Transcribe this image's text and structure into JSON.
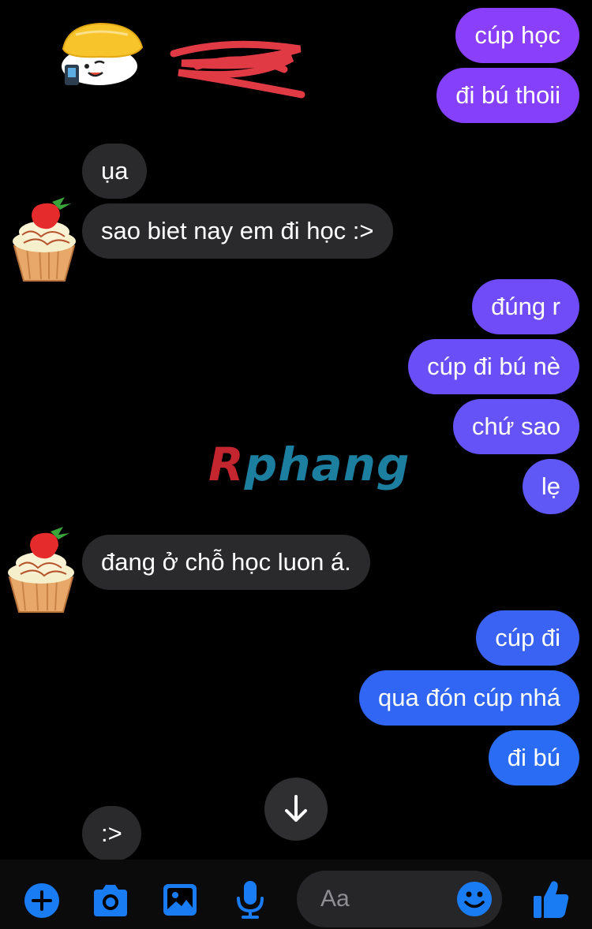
{
  "messages": {
    "m1": "cúp học",
    "m2": "đi bú thoii",
    "m3": "ụa",
    "m4": "sao biet nay em đi học :>",
    "m5": "đúng r",
    "m6": "cúp đi bú nè",
    "m7": "chứ sao",
    "m8": "lẹ",
    "m9": "đang ở chỗ học luon á.",
    "m10": "cúp đi",
    "m11": "qua đón cúp nhá",
    "m12": "đi bú",
    "m13": ":>"
  },
  "watermark": {
    "first": "R",
    "rest": "phang"
  },
  "composer": {
    "placeholder": "Aa"
  },
  "colors": {
    "incoming": "#2a2a2c",
    "gradient_top": "#8a3ffb",
    "gradient_mid": "#5b5cf6",
    "gradient_bottom": "#2a6cf3",
    "accent": "#1a7cf3"
  },
  "icons": [
    "sushi-sticker",
    "cupcake-avatar",
    "arrow-down-icon",
    "plus-circle-icon",
    "camera-icon",
    "image-icon",
    "microphone-icon",
    "emoji-icon",
    "thumbs-up-icon"
  ]
}
